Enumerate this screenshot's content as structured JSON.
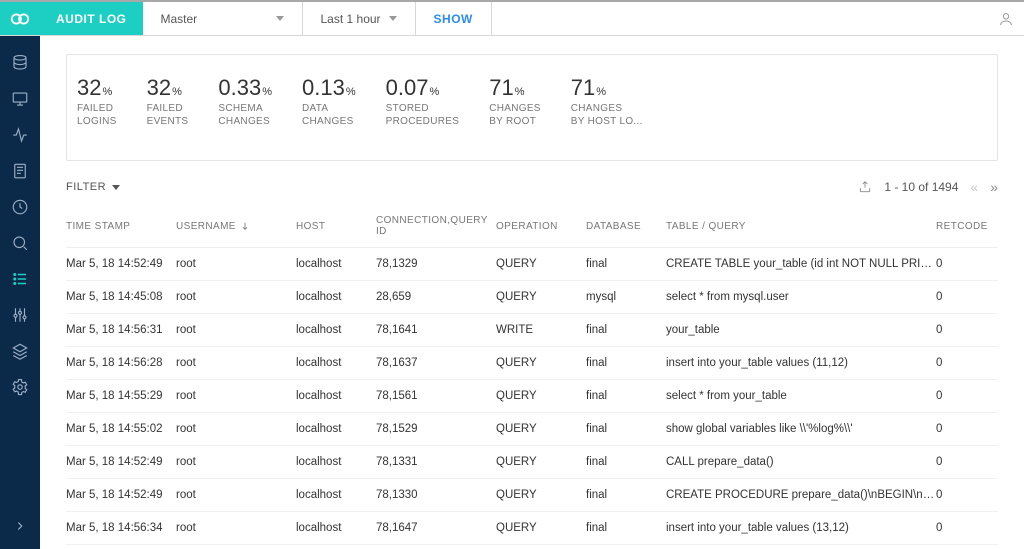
{
  "header": {
    "title": "AUDIT LOG",
    "cluster_select": "Master",
    "time_select": "Last 1 hour",
    "show_label": "SHOW"
  },
  "stats": [
    {
      "value": "32",
      "unit": "%",
      "label": "FAILED\nLOGINS"
    },
    {
      "value": "32",
      "unit": "%",
      "label": "FAILED\nEVENTS"
    },
    {
      "value": "0.33",
      "unit": "%",
      "label": "SCHEMA\nCHANGES"
    },
    {
      "value": "0.13",
      "unit": "%",
      "label": "DATA\nCHANGES"
    },
    {
      "value": "0.07",
      "unit": "%",
      "label": "STORED\nPROCEDURES"
    },
    {
      "value": "71",
      "unit": "%",
      "label": "CHANGES\nBY ROOT"
    },
    {
      "value": "71",
      "unit": "%",
      "label": "CHANGES\nBY HOST LO..."
    }
  ],
  "filter_label": "FILTER",
  "pager": {
    "range": "1 - 10 of 1494"
  },
  "columns": {
    "timestamp": "TIME STAMP",
    "username": "USERNAME",
    "host": "HOST",
    "conn": "CONNECTION,QUERY ID",
    "operation": "OPERATION",
    "database": "DATABASE",
    "query": "TABLE / QUERY",
    "retcode": "RETCODE"
  },
  "rows": [
    {
      "ts": "Mar 5, 18 14:52:49",
      "user": "root",
      "host": "localhost",
      "conn": "78,1329",
      "op": "QUERY",
      "db": "final",
      "query": "CREATE TABLE your_table (id int NOT NULL PRIMARY...",
      "ret": "0"
    },
    {
      "ts": "Mar 5, 18 14:45:08",
      "user": "root",
      "host": "localhost",
      "conn": "28,659",
      "op": "QUERY",
      "db": "mysql",
      "query": "select * from mysql.user",
      "ret": "0"
    },
    {
      "ts": "Mar 5, 18 14:56:31",
      "user": "root",
      "host": "localhost",
      "conn": "78,1641",
      "op": "WRITE",
      "db": "final",
      "query": "your_table",
      "ret": "0"
    },
    {
      "ts": "Mar 5, 18 14:56:28",
      "user": "root",
      "host": "localhost",
      "conn": "78,1637",
      "op": "QUERY",
      "db": "final",
      "query": "insert into your_table values (11,12)",
      "ret": "0"
    },
    {
      "ts": "Mar 5, 18 14:55:29",
      "user": "root",
      "host": "localhost",
      "conn": "78,1561",
      "op": "QUERY",
      "db": "final",
      "query": "select * from your_table",
      "ret": "0"
    },
    {
      "ts": "Mar 5, 18 14:55:02",
      "user": "root",
      "host": "localhost",
      "conn": "78,1529",
      "op": "QUERY",
      "db": "final",
      "query": "show global variables like \\\\'%log%\\\\'",
      "ret": "0"
    },
    {
      "ts": "Mar 5, 18 14:52:49",
      "user": "root",
      "host": "localhost",
      "conn": "78,1331",
      "op": "QUERY",
      "db": "final",
      "query": "CALL prepare_data()",
      "ret": "0"
    },
    {
      "ts": "Mar 5, 18 14:52:49",
      "user": "root",
      "host": "localhost",
      "conn": "78,1330",
      "op": "QUERY",
      "db": "final",
      "query": "CREATE PROCEDURE prepare_data()\\nBEGIN\\n DEC...",
      "ret": "0"
    },
    {
      "ts": "Mar 5, 18 14:56:34",
      "user": "root",
      "host": "localhost",
      "conn": "78,1647",
      "op": "QUERY",
      "db": "final",
      "query": "insert into your_table values (13,12)",
      "ret": "0"
    }
  ]
}
